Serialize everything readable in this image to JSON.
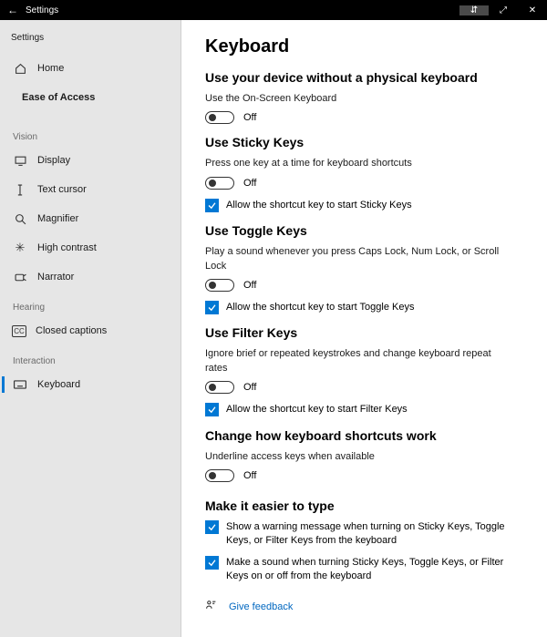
{
  "titlebar": {
    "back_glyph": "←",
    "title": "Settings",
    "pin_glyph": "⇵",
    "max_glyph": "⤢",
    "close_glyph": "✕"
  },
  "sidebar": {
    "top_label": "Settings",
    "home_label": "Home",
    "ease_label": "Ease of Access",
    "group_vision": "Vision",
    "items_vision": [
      {
        "icon": "display",
        "label": "Display"
      },
      {
        "icon": "text",
        "label": "Text cursor"
      },
      {
        "icon": "magnifier",
        "label": "Magnifier"
      },
      {
        "icon": "contrast",
        "label": "High contrast"
      },
      {
        "icon": "narrator",
        "label": "Narrator"
      }
    ],
    "group_hearing": "Hearing",
    "items_hearing": [
      {
        "icon": "cc",
        "label": "Closed captions"
      }
    ],
    "group_interaction": "Interaction",
    "items_interaction": [
      {
        "icon": "keyboard",
        "label": "Keyboard"
      }
    ]
  },
  "main": {
    "title": "Keyboard",
    "osk": {
      "heading": "Use your device without a physical keyboard",
      "desc": "Use the On-Screen Keyboard",
      "state": "Off"
    },
    "sticky": {
      "heading": "Use Sticky Keys",
      "desc": "Press one key at a time for keyboard shortcuts",
      "state": "Off",
      "check": "Allow the shortcut key to start Sticky Keys"
    },
    "toggle": {
      "heading": "Use Toggle Keys",
      "desc": "Play a sound whenever you press Caps Lock, Num Lock, or Scroll Lock",
      "state": "Off",
      "check": "Allow the shortcut key to start Toggle Keys"
    },
    "filter": {
      "heading": "Use Filter Keys",
      "desc": "Ignore brief or repeated keystrokes and change keyboard repeat rates",
      "state": "Off",
      "check": "Allow the shortcut key to start Filter Keys"
    },
    "shortcuts": {
      "heading": "Change how keyboard shortcuts work",
      "desc": "Underline access keys when available",
      "state": "Off"
    },
    "easier": {
      "heading": "Make it easier to type",
      "check1": "Show a warning message when turning on Sticky Keys, Toggle Keys, or Filter Keys from the keyboard",
      "check2": "Make a sound when turning Sticky Keys, Toggle Keys, or Filter Keys on or off from the keyboard"
    },
    "feedback": "Give feedback"
  }
}
